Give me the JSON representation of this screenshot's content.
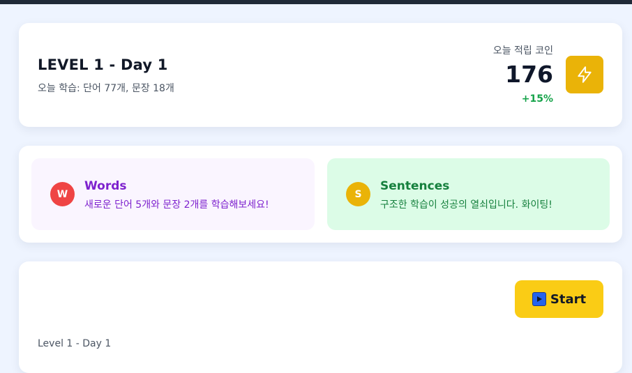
{
  "header": {
    "level_title": "LEVEL 1 - Day 1",
    "today_summary": "오늘 학습: 단어 77개, 문장 18개",
    "coins_label": "오늘 적립 코인",
    "coins_value": "176",
    "coins_change": "+15%",
    "action_icon": "bolt-icon"
  },
  "tiles": {
    "words": {
      "badge": "W",
      "title": "Words",
      "description": "새로운 단어 5개와 문장 2개를 학습해보세요!"
    },
    "sentences": {
      "badge": "S",
      "title": "Sentences",
      "description": "구조한 학습이 성공의 열쇠입니다. 화이팅!"
    }
  },
  "session": {
    "start_label": "Start",
    "start_icon": "play-icon",
    "caption": "Level 1 - Day 1"
  },
  "colors": {
    "accent_yellow": "#facc15",
    "coin_button": "#eab308",
    "positive_green": "#16a34a",
    "words_purple": "#7e22ce",
    "sentences_green": "#15803d",
    "badge_red": "#ef4444"
  }
}
